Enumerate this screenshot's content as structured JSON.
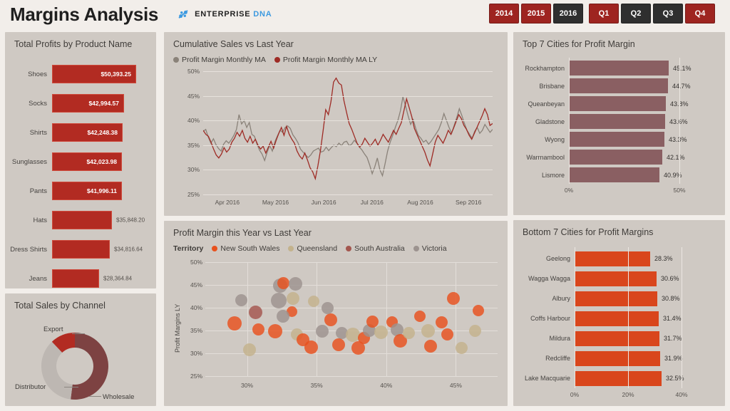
{
  "header": {
    "title": "Margins Analysis",
    "brand_primary": "ENTERPRISE",
    "brand_secondary": "DNA",
    "brand_icon": "enterprise-dna-logo-icon",
    "brand_accent": "#3d9ae0"
  },
  "slicers": {
    "years": [
      {
        "label": "2014",
        "selected": false
      },
      {
        "label": "2015",
        "selected": false
      },
      {
        "label": "2016",
        "selected": true
      }
    ],
    "quarters": [
      {
        "label": "Q1",
        "selected": false
      },
      {
        "label": "Q2",
        "selected": true
      },
      {
        "label": "Q3",
        "selected": true
      },
      {
        "label": "Q4",
        "selected": false
      }
    ],
    "selected_color": "#2f2f2f",
    "unselected_color": "#9e2420"
  },
  "chart_data": [
    {
      "id": "total-profits-by-product",
      "type": "bar",
      "title": "Total Profits by Product Name",
      "orientation": "horizontal",
      "xlabel": "",
      "ylabel": "",
      "categories": [
        "Shoes",
        "Socks",
        "Shirts",
        "Sunglasses",
        "Pants",
        "Hats",
        "Dress Shirts",
        "Jeans"
      ],
      "values": [
        50393.25,
        42994.57,
        42248.38,
        42023.98,
        41996.11,
        35848.2,
        34816.64,
        28364.84
      ],
      "labels": [
        "$50,393.25",
        "$42,994.57",
        "$42,248.38",
        "$42,023.98",
        "$41,996.11",
        "$35,848.20",
        "$34,816.64",
        "$28,364.84"
      ],
      "label_inside": [
        true,
        true,
        true,
        true,
        true,
        false,
        false,
        false
      ],
      "bar_color": "#b22b22",
      "grid": false
    },
    {
      "id": "total-sales-by-channel",
      "type": "pie",
      "subtype": "donut",
      "title": "Total Sales by Channel",
      "categories": [
        "Wholesale",
        "Distributor",
        "Export"
      ],
      "values": [
        52,
        36,
        12
      ],
      "colors": [
        "#7d4242",
        "#bdb7b2",
        "#b22b22"
      ],
      "legend_position": "callout-labels"
    },
    {
      "id": "cumulative-sales-vs-last-year",
      "type": "line",
      "title": "Cumulative Sales vs Last Year",
      "xlabel": "",
      "ylabel": "",
      "ylim": [
        25,
        50
      ],
      "yticks": [
        "25%",
        "30%",
        "35%",
        "40%",
        "45%",
        "50%"
      ],
      "xticks": [
        "Apr 2016",
        "May 2016",
        "Jun 2016",
        "Jul 2016",
        "Aug 2016",
        "Sep 2016"
      ],
      "grid": true,
      "series": [
        {
          "name": "Profit Margin Monthly MA",
          "color": "#8a8279",
          "values": [
            37.8,
            38.2,
            36.6,
            35.4,
            36.3,
            35.1,
            34.3,
            33.8,
            35.2,
            35.9,
            35.4,
            36.1,
            37.0,
            38.2,
            41.2,
            39.3,
            40.0,
            38.6,
            39.6,
            37.2,
            36.8,
            35.2,
            34.0,
            33.2,
            31.9,
            33.6,
            34.9,
            33.8,
            35.7,
            36.9,
            38.0,
            37.6,
            38.6,
            38.9,
            38.4,
            37.1,
            36.4,
            35.5,
            34.2,
            33.6,
            33.0,
            32.5,
            33.0,
            33.8,
            34.1,
            34.4,
            33.6,
            33.8,
            34.6,
            33.9,
            34.5,
            35.0,
            34.7,
            35.4,
            34.9,
            35.6,
            35.8,
            34.9,
            35.2,
            36.0,
            35.4,
            34.6,
            34.0,
            33.2,
            32.5,
            31.0,
            29.2,
            30.6,
            32.4,
            30.0,
            28.8,
            31.2,
            33.8,
            35.6,
            37.0,
            38.6,
            40.0,
            42.0,
            44.8,
            43.0,
            41.0,
            39.2,
            40.2,
            38.4,
            37.0,
            36.4,
            35.6,
            36.0,
            35.2,
            35.8,
            36.6,
            37.4,
            38.2,
            39.6,
            41.4,
            40.0,
            38.6,
            37.4,
            39.0,
            40.6,
            42.4,
            41.0,
            39.4,
            38.0,
            37.2,
            36.4,
            37.8,
            38.6,
            37.4,
            38.0,
            39.2,
            38.4,
            37.6,
            38.2
          ]
        },
        {
          "name": "Profit Margin Monthly MA LY",
          "color": "#9e2b25",
          "values": [
            38.0,
            37.2,
            36.8,
            35.6,
            34.2,
            33.0,
            32.4,
            33.2,
            34.5,
            33.6,
            34.2,
            35.6,
            36.4,
            37.6,
            36.8,
            38.0,
            36.4,
            35.6,
            36.8,
            35.4,
            36.2,
            35.0,
            34.2,
            34.8,
            33.4,
            34.6,
            35.8,
            34.4,
            36.0,
            37.4,
            38.6,
            37.0,
            38.8,
            37.2,
            36.2,
            35.4,
            33.8,
            32.8,
            32.2,
            33.4,
            32.0,
            30.4,
            29.6,
            28.2,
            30.8,
            34.0,
            38.0,
            42.2,
            41.2,
            43.8,
            47.8,
            48.6,
            47.6,
            47.2,
            44.0,
            41.6,
            39.4,
            38.2,
            36.8,
            35.4,
            34.6,
            35.2,
            36.4,
            35.6,
            34.8,
            35.4,
            36.2,
            35.0,
            36.0,
            37.2,
            36.4,
            35.6,
            36.8,
            38.0,
            37.2,
            38.4,
            39.6,
            42.0,
            44.4,
            42.6,
            40.8,
            38.4,
            37.2,
            36.0,
            34.8,
            33.6,
            32.0,
            30.8,
            33.2,
            35.6,
            37.0,
            36.2,
            35.4,
            36.6,
            38.0,
            37.2,
            38.4,
            39.8,
            41.2,
            40.4,
            39.0,
            38.2,
            37.0,
            36.2,
            37.4,
            38.6,
            39.8,
            41.0,
            42.4,
            41.2,
            39.0,
            39.4
          ]
        }
      ]
    },
    {
      "id": "profit-margin-this-year-vs-last-year",
      "type": "scatter",
      "title": "Profit Margin this Year vs Last Year",
      "legend_title": "Territory",
      "legend_position": "top",
      "xlabel": "",
      "ylabel": "Profit Margins LY",
      "xlim": [
        27,
        48
      ],
      "ylim": [
        25,
        50
      ],
      "xticks": [
        "30%",
        "35%",
        "40%",
        "45%"
      ],
      "yticks": [
        "25%",
        "30%",
        "35%",
        "40%",
        "45%",
        "50%"
      ],
      "grid": true,
      "series": [
        {
          "name": "New South Wales",
          "color": "#e8511d"
        },
        {
          "name": "Queensland",
          "color": "#c3b28c"
        },
        {
          "name": "South Australia",
          "color": "#a3564e"
        },
        {
          "name": "Victoria",
          "color": "#9c938f"
        }
      ],
      "points": [
        {
          "territory": 0,
          "x": 29.1,
          "y": 36.6,
          "r": 20
        },
        {
          "territory": 3,
          "x": 29.6,
          "y": 41.6,
          "r": 17
        },
        {
          "territory": 2,
          "x": 30.6,
          "y": 39.0,
          "r": 19
        },
        {
          "territory": 0,
          "x": 30.8,
          "y": 35.2,
          "r": 17
        },
        {
          "territory": 1,
          "x": 30.2,
          "y": 30.8,
          "r": 18
        },
        {
          "territory": 3,
          "x": 32.4,
          "y": 44.8,
          "r": 20
        },
        {
          "territory": 0,
          "x": 32.6,
          "y": 45.4,
          "r": 17
        },
        {
          "territory": 3,
          "x": 33.5,
          "y": 45.2,
          "r": 19
        },
        {
          "territory": 3,
          "x": 32.3,
          "y": 41.6,
          "r": 22
        },
        {
          "territory": 1,
          "x": 33.3,
          "y": 42.0,
          "r": 18
        },
        {
          "territory": 0,
          "x": 33.2,
          "y": 39.2,
          "r": 15
        },
        {
          "territory": 3,
          "x": 32.6,
          "y": 38.2,
          "r": 18
        },
        {
          "territory": 0,
          "x": 32.0,
          "y": 34.8,
          "r": 20
        },
        {
          "territory": 1,
          "x": 33.6,
          "y": 34.2,
          "r": 17
        },
        {
          "territory": 0,
          "x": 34.0,
          "y": 33.0,
          "r": 18
        },
        {
          "territory": 0,
          "x": 34.6,
          "y": 31.4,
          "r": 19
        },
        {
          "territory": 3,
          "x": 35.4,
          "y": 34.8,
          "r": 18
        },
        {
          "territory": 0,
          "x": 36.0,
          "y": 37.4,
          "r": 18
        },
        {
          "territory": 3,
          "x": 36.8,
          "y": 34.4,
          "r": 17
        },
        {
          "territory": 0,
          "x": 36.6,
          "y": 31.8,
          "r": 18
        },
        {
          "territory": 1,
          "x": 37.6,
          "y": 34.0,
          "r": 20
        },
        {
          "territory": 0,
          "x": 38.4,
          "y": 33.4,
          "r": 17
        },
        {
          "territory": 3,
          "x": 38.8,
          "y": 35.0,
          "r": 18
        },
        {
          "territory": 0,
          "x": 39.0,
          "y": 37.0,
          "r": 17
        },
        {
          "territory": 1,
          "x": 39.6,
          "y": 34.6,
          "r": 19
        },
        {
          "territory": 0,
          "x": 40.4,
          "y": 36.8,
          "r": 16
        },
        {
          "territory": 3,
          "x": 40.8,
          "y": 35.2,
          "r": 18
        },
        {
          "territory": 0,
          "x": 41.0,
          "y": 32.8,
          "r": 19
        },
        {
          "territory": 1,
          "x": 41.6,
          "y": 34.4,
          "r": 17
        },
        {
          "territory": 0,
          "x": 42.4,
          "y": 38.2,
          "r": 16
        },
        {
          "territory": 1,
          "x": 43.0,
          "y": 35.0,
          "r": 19
        },
        {
          "territory": 0,
          "x": 44.0,
          "y": 36.8,
          "r": 17
        },
        {
          "territory": 0,
          "x": 44.4,
          "y": 34.2,
          "r": 17
        },
        {
          "territory": 0,
          "x": 43.2,
          "y": 31.6,
          "r": 18
        },
        {
          "territory": 1,
          "x": 45.4,
          "y": 31.2,
          "r": 17
        },
        {
          "territory": 0,
          "x": 44.8,
          "y": 42.0,
          "r": 18
        },
        {
          "territory": 0,
          "x": 46.6,
          "y": 39.4,
          "r": 16
        },
        {
          "territory": 1,
          "x": 46.4,
          "y": 35.0,
          "r": 17
        },
        {
          "territory": 3,
          "x": 35.8,
          "y": 40.0,
          "r": 17
        },
        {
          "territory": 1,
          "x": 34.8,
          "y": 41.4,
          "r": 16
        },
        {
          "territory": 0,
          "x": 38.0,
          "y": 31.2,
          "r": 19
        }
      ]
    },
    {
      "id": "top-7-cities-for-profit-margin",
      "type": "bar",
      "title": "Top 7 Cities for Profit Margin",
      "orientation": "horizontal",
      "categories": [
        "Rockhampton",
        "Brisbane",
        "Queanbeyan",
        "Gladstone",
        "Wyong",
        "Warrnambool",
        "Lismore"
      ],
      "values": [
        45.1,
        44.7,
        43.8,
        43.6,
        43.3,
        42.1,
        40.9
      ],
      "labels": [
        "45.1%",
        "44.7%",
        "43.8%",
        "43.6%",
        "43.3%",
        "42.1%",
        "40.9%"
      ],
      "xticks": [
        "0%",
        "50%"
      ],
      "xlim": [
        0,
        50
      ],
      "bar_color": "#8a5f62",
      "grid": true
    },
    {
      "id": "bottom-7-cities-for-profit-margins",
      "type": "bar",
      "title": "Bottom 7 Cities for Profit Margins",
      "orientation": "horizontal",
      "categories": [
        "Geelong",
        "Wagga Wagga",
        "Albury",
        "Coffs Harbour",
        "Mildura",
        "Redcliffe",
        "Lake Macquarie"
      ],
      "values": [
        28.3,
        30.6,
        30.8,
        31.4,
        31.7,
        31.9,
        32.5
      ],
      "labels": [
        "28.3%",
        "30.6%",
        "30.8%",
        "31.4%",
        "31.7%",
        "31.9%",
        "32.5%"
      ],
      "xticks": [
        "0%",
        "20%",
        "40%"
      ],
      "xlim": [
        0,
        40
      ],
      "bar_color": "#d9461c",
      "grid": true
    }
  ]
}
